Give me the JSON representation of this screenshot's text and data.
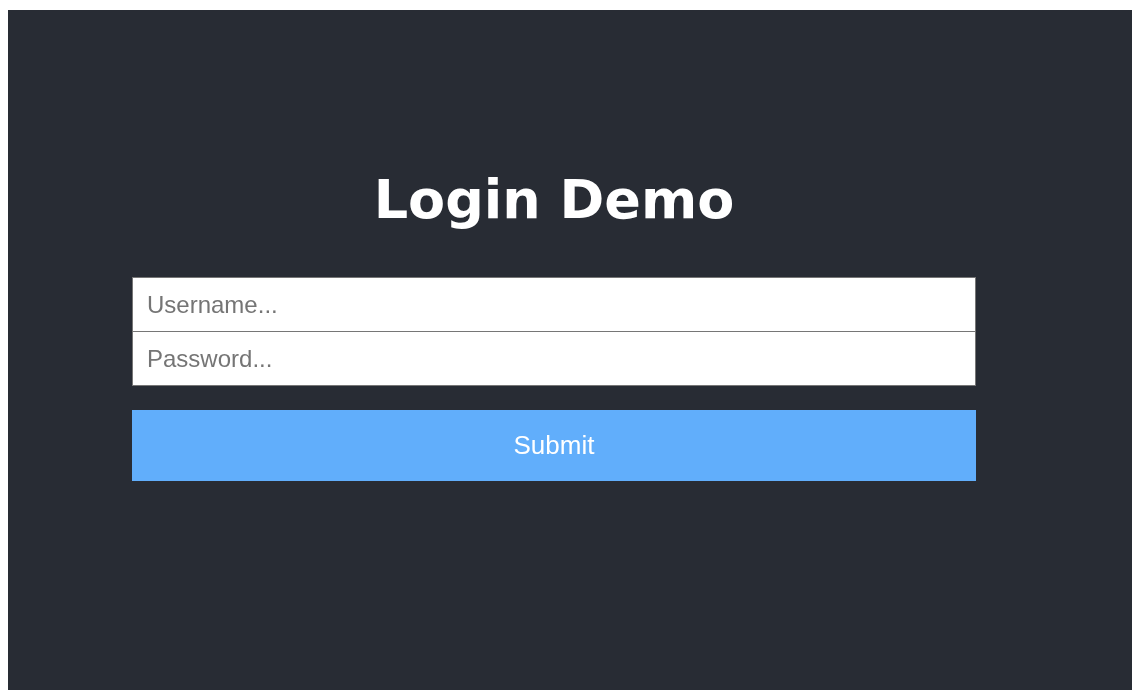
{
  "title": "Login Demo",
  "fields": [
    {
      "placeholder": "Username..."
    },
    {
      "placeholder": "Password..."
    }
  ],
  "submit": "Submit"
}
